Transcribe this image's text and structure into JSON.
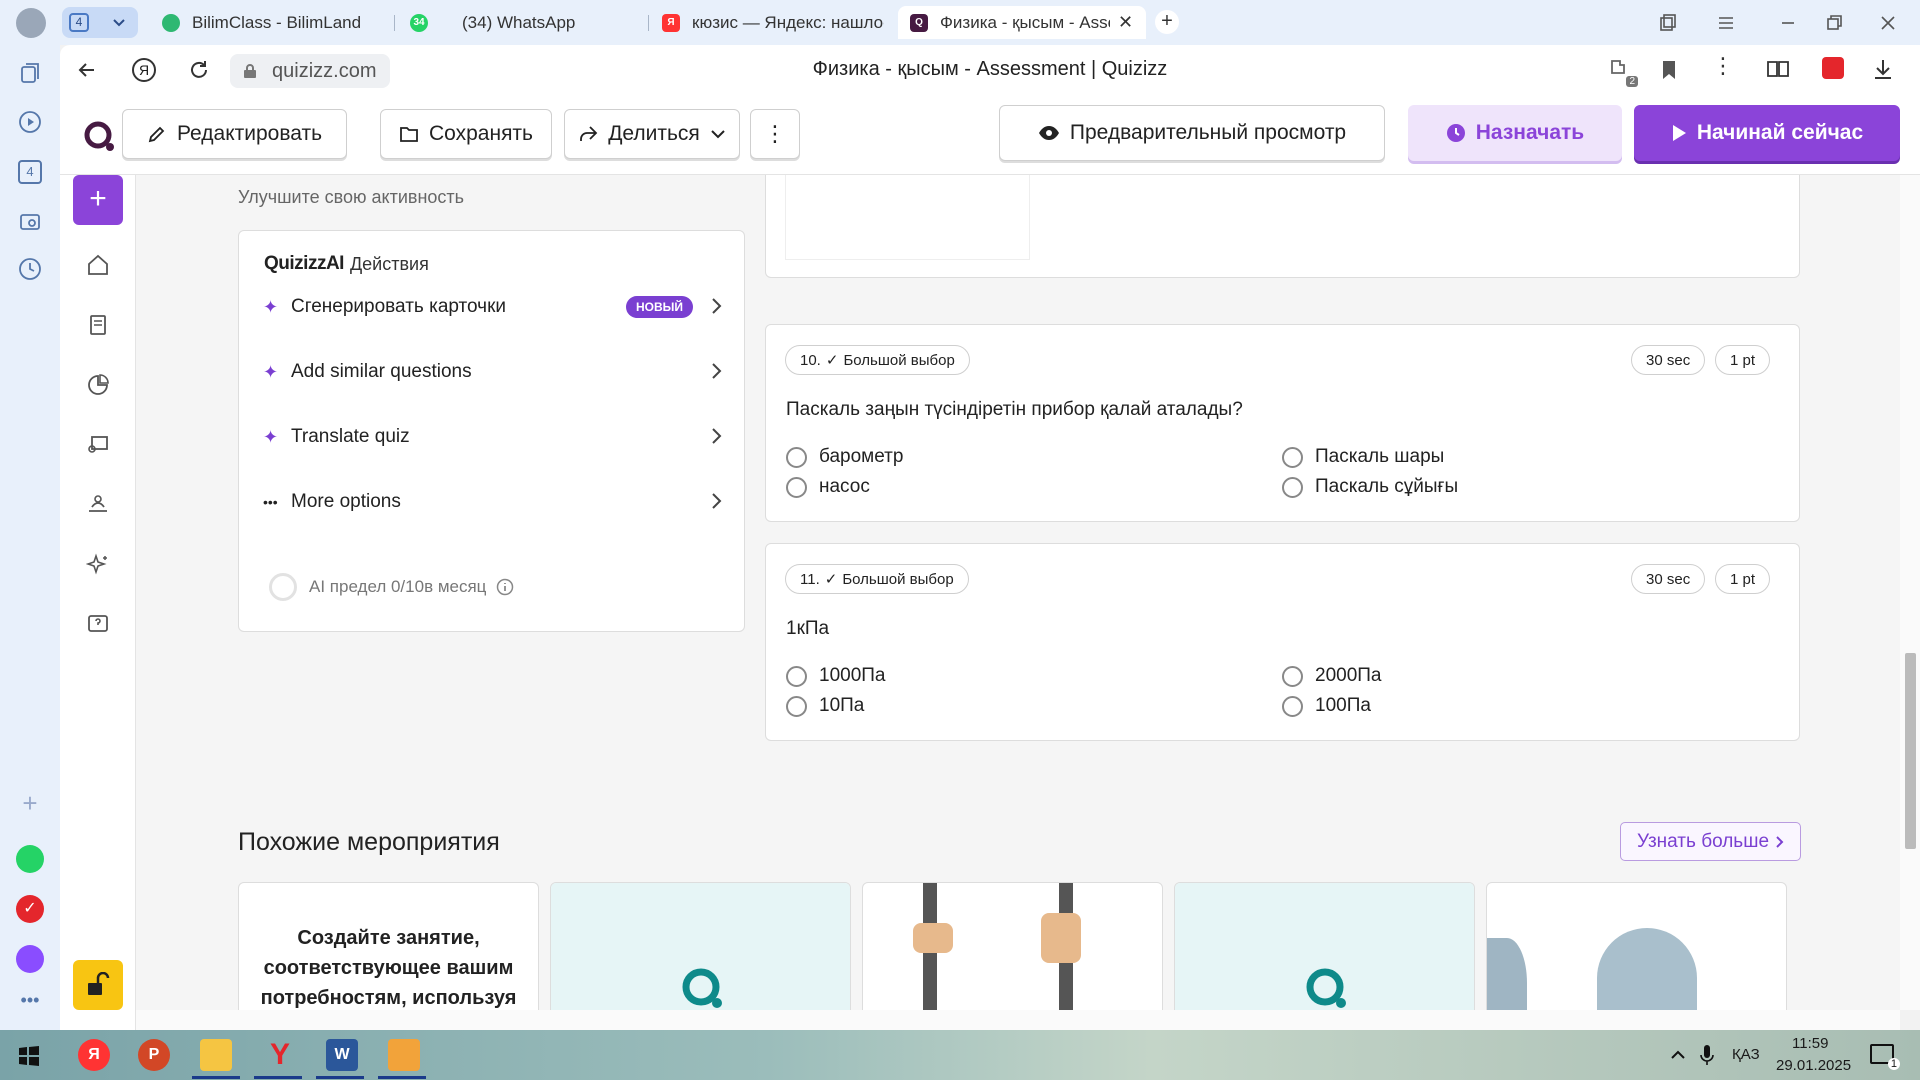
{
  "browser": {
    "tab_group_count": "4",
    "tabs": [
      {
        "title": "BilimClass - BilimLand",
        "color": "#2eb872"
      },
      {
        "title": "(34) WhatsApp",
        "badge": "34",
        "color": "#25d366"
      },
      {
        "title": "кюзис — Яндекс: нашлось",
        "color": "#f33"
      },
      {
        "title": "Физика - қысым - Asse",
        "color": "#461a42"
      }
    ],
    "url": "quizizz.com",
    "page_title": "Физика - қысым - Assessment | Quizizz",
    "extension_badge": "2"
  },
  "toolbar": {
    "edit": "Редактировать",
    "save": "Сохранять",
    "share": "Делиться",
    "preview": "Предварительный просмотр",
    "assign": "Назначать",
    "start": "Начинай сейчас"
  },
  "ai_panel": {
    "section_label": "Улучшите свою активность",
    "brand": "QuizizzAI",
    "brand_suffix": "Действия",
    "items": [
      {
        "label": "Сгенерировать карточки",
        "badge": "НОВЫЙ"
      },
      {
        "label": "Add similar questions"
      },
      {
        "label": "Translate quiz"
      },
      {
        "label": "More options"
      }
    ],
    "limit": "AI предел 0/10в месяц"
  },
  "questions": [
    {
      "number": "10.",
      "type": "Большой выбор",
      "time": "30 sec",
      "points": "1 pt",
      "text": "Паскаль заңын түсіндіретін прибор қалай аталады?",
      "options": [
        "барометр",
        "Паскаль шары",
        "насос",
        "Паскаль сұйығы"
      ]
    },
    {
      "number": "11.",
      "type": "Большой выбор",
      "time": "30 sec",
      "points": "1 pt",
      "text": "1кПа",
      "options": [
        "1000Па",
        "2000Па",
        "10Па",
        "100Па"
      ]
    }
  ],
  "similar": {
    "title": "Похожие мероприятия",
    "learn_more": "Узнать больше",
    "create_tile": "Создайте занятие, соответствующее вашим потребностям, используя"
  },
  "taskbar": {
    "lang": "ҚАЗ",
    "time": "11:59",
    "date": "29.01.2025",
    "notifications": "1"
  }
}
